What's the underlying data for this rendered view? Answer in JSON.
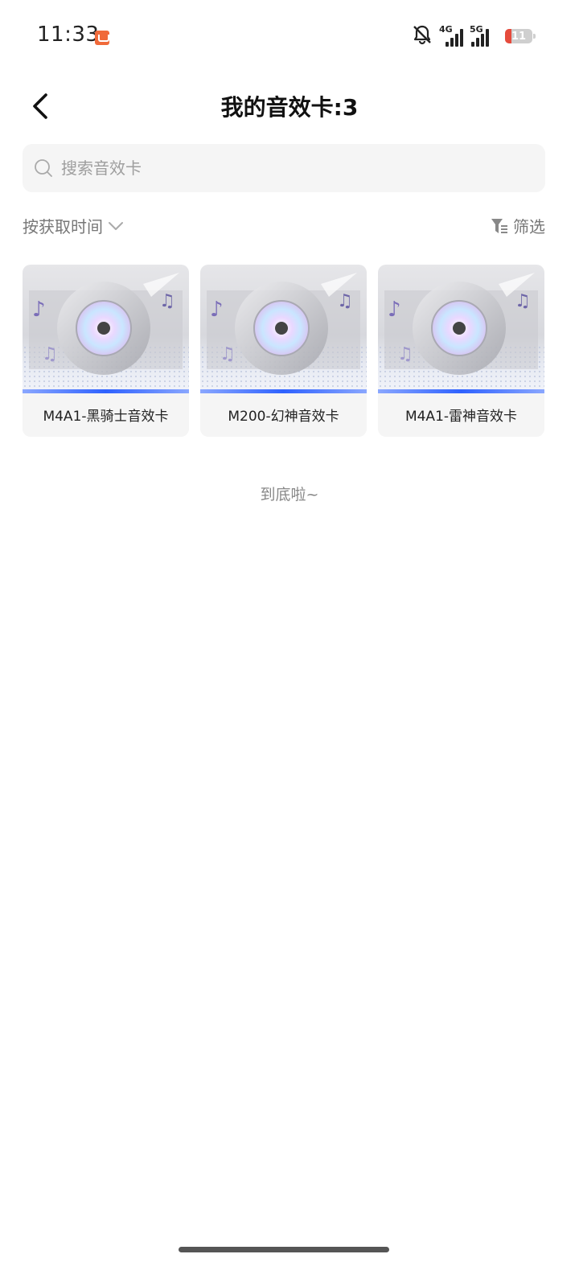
{
  "status_bar": {
    "time": "11:33",
    "icons": [
      "app-notification-icon",
      "bell-off-icon",
      "signal-4g-icon",
      "signal-5g-icon",
      "battery-icon"
    ],
    "network_1": "4G",
    "network_2": "5G",
    "battery": "11"
  },
  "header": {
    "title": "我的音效卡:3",
    "back_icon": "chevron-left-icon"
  },
  "search": {
    "placeholder": "搜索音效卡",
    "icon": "search-icon"
  },
  "toolbar": {
    "sort_label": "按获取时间",
    "sort_icon": "chevron-down-icon",
    "filter_label": "筛选",
    "filter_icon": "filter-icon"
  },
  "cards": [
    {
      "label": "M4A1-黑骑士音效卡",
      "icon": "disc-icon"
    },
    {
      "label": "M200-幻神音效卡",
      "icon": "disc-icon"
    },
    {
      "label": "M4A1-雷神音效卡",
      "icon": "disc-icon"
    }
  ],
  "footer": {
    "end_text": "到底啦~"
  },
  "colors": {
    "accent": "#2f62ff",
    "battery_low": "#e64b3c",
    "card_bg": "#f5f5f5"
  }
}
